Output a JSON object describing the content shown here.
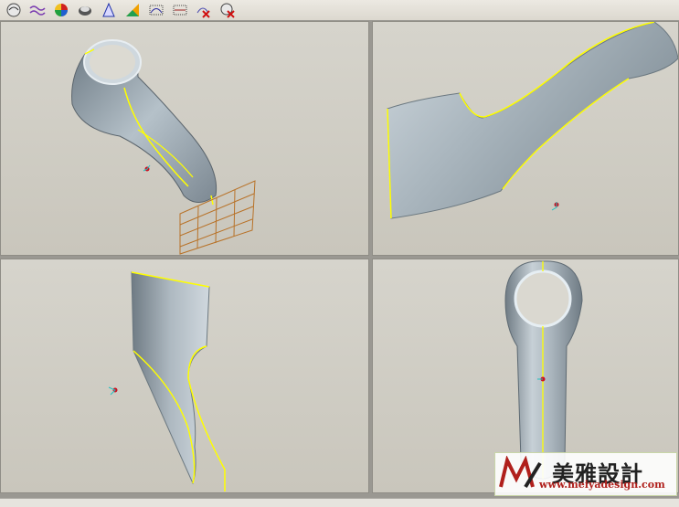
{
  "toolbar": {
    "buttons": [
      {
        "name": "shade-icon"
      },
      {
        "name": "wave-analysis-icon"
      },
      {
        "name": "color-map-icon"
      },
      {
        "name": "section-icon"
      },
      {
        "name": "draft-icon"
      },
      {
        "name": "reflection-icon"
      },
      {
        "name": "curvature-plot-icon"
      },
      {
        "name": "deviation-icon"
      },
      {
        "name": "delete-analysis-icon"
      },
      {
        "name": "delete-all-icon"
      }
    ]
  },
  "watermark": {
    "brand": "美雅設計",
    "url": "www.meiyadesign.com"
  },
  "colors": {
    "viewport_bg": "#d2d0c8",
    "part_surface": "#9aa7b0",
    "edge_highlight": "#f2f200",
    "grid": "#b8702a",
    "toolbar_bg": "#e4e1d9"
  }
}
